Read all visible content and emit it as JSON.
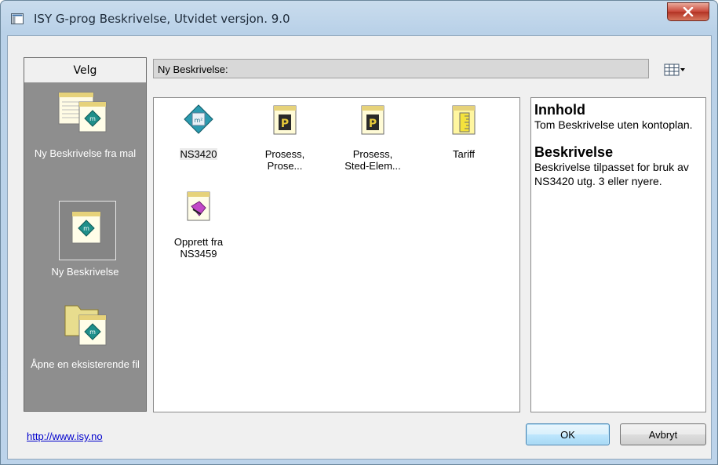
{
  "window": {
    "title": "ISY G-prog Beskrivelse, Utvidet versjon. 9.0",
    "close_label": "X"
  },
  "left_panel": {
    "header": "Velg",
    "items": [
      {
        "label": "Ny Beskrivelse fra mal",
        "icon": "template-document-icon"
      },
      {
        "label": "Ny Beskrivelse",
        "icon": "new-document-icon",
        "selected": true
      },
      {
        "label": "Åpne en eksisterende fil",
        "icon": "open-folder-icon"
      }
    ]
  },
  "path_bar": {
    "text": "Ny Beskrivelse:"
  },
  "templates": [
    {
      "label": "NS3420",
      "icon": "ns3420-diamond-icon",
      "selected": true
    },
    {
      "label": "Prosess,\nProse...",
      "icon": "p-notepad-icon"
    },
    {
      "label": "Prosess,\nSted-Elem...",
      "icon": "p-notepad-icon"
    },
    {
      "label": "Tariff",
      "icon": "ruler-notepad-icon"
    },
    {
      "label": "Opprett fra\nNS3459",
      "icon": "import-notepad-icon"
    }
  ],
  "description": {
    "heading1": "Innhold",
    "text1": "Tom Beskrivelse uten kontoplan.",
    "heading2": "Beskrivelse",
    "text2": "Beskrivelse tilpasset for bruk av NS3420 utg. 3 eller nyere."
  },
  "footer": {
    "url": "http://www.isy.no",
    "ok_label": "OK",
    "cancel_label": "Avbryt"
  },
  "colors": {
    "panel_gray": "#8e8e8e",
    "accent_teal": "#1f8f8a",
    "link_blue": "#0000cc",
    "close_red": "#c9483a"
  }
}
